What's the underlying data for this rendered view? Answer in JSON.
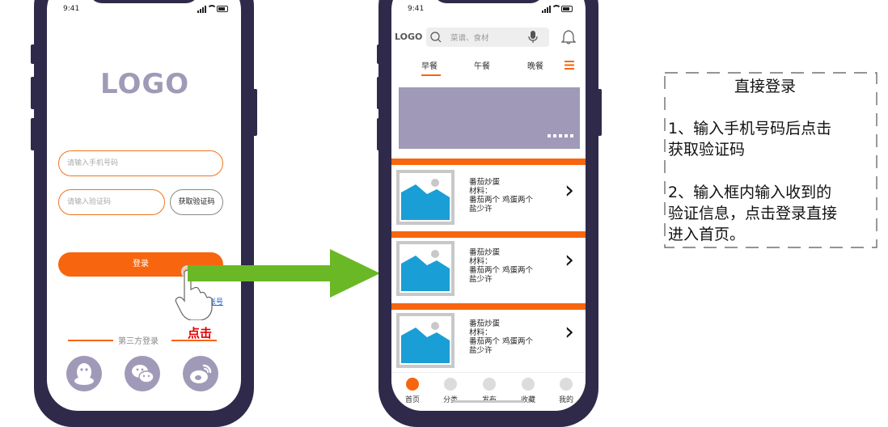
{
  "status_time": "9:41",
  "login_screen": {
    "logo": "LOGO",
    "phone_placeholder": "请输入手机号码",
    "code_placeholder": "请输入验证码",
    "get_code_label": "获取验证码",
    "login_label": "登录",
    "other_account_label": "账号",
    "third_party_label": "第三方登录",
    "social_icons": [
      "qq-icon",
      "wechat-icon",
      "weibo-icon"
    ]
  },
  "home_screen": {
    "logo": "LOGO",
    "search_placeholder": "菜谱、食材",
    "tabs": [
      {
        "label": "早餐",
        "active": true
      },
      {
        "label": "午餐",
        "active": false
      },
      {
        "label": "晚餐",
        "active": false
      }
    ],
    "recipes": [
      {
        "title": "番茄炒蛋",
        "label": "材料：",
        "ingredients": "番茄两个 鸡蛋两个",
        "extra": "盐少许"
      },
      {
        "title": "番茄炒蛋",
        "label": "材料：",
        "ingredients": "番茄两个 鸡蛋两个",
        "extra": "盐少许"
      },
      {
        "title": "番茄炒蛋",
        "label": "材料：",
        "ingredients": "番茄两个 鸡蛋两个",
        "extra": "盐少许"
      }
    ],
    "nav": [
      {
        "label": "首页",
        "active": true
      },
      {
        "label": "分类",
        "active": false
      },
      {
        "label": "发布",
        "active": false
      },
      {
        "label": "收藏",
        "active": false
      },
      {
        "label": "我的",
        "active": false
      }
    ]
  },
  "annotation": {
    "click_label": "点击",
    "title": "直接登录",
    "step1_line1": "1、输入手机号码后点击",
    "step1_line2": "获取验证码",
    "step2_line1": "2、输入框内输入收到的",
    "step2_line2": "验证信息，点击登录直接",
    "step2_line3": "进入首页。"
  },
  "colors": {
    "frame": "#2f2a4a",
    "accent": "#f7660e",
    "logo": "#a09ab8",
    "arrow": "#6ab825",
    "image_blue": "#1a9ed6"
  }
}
